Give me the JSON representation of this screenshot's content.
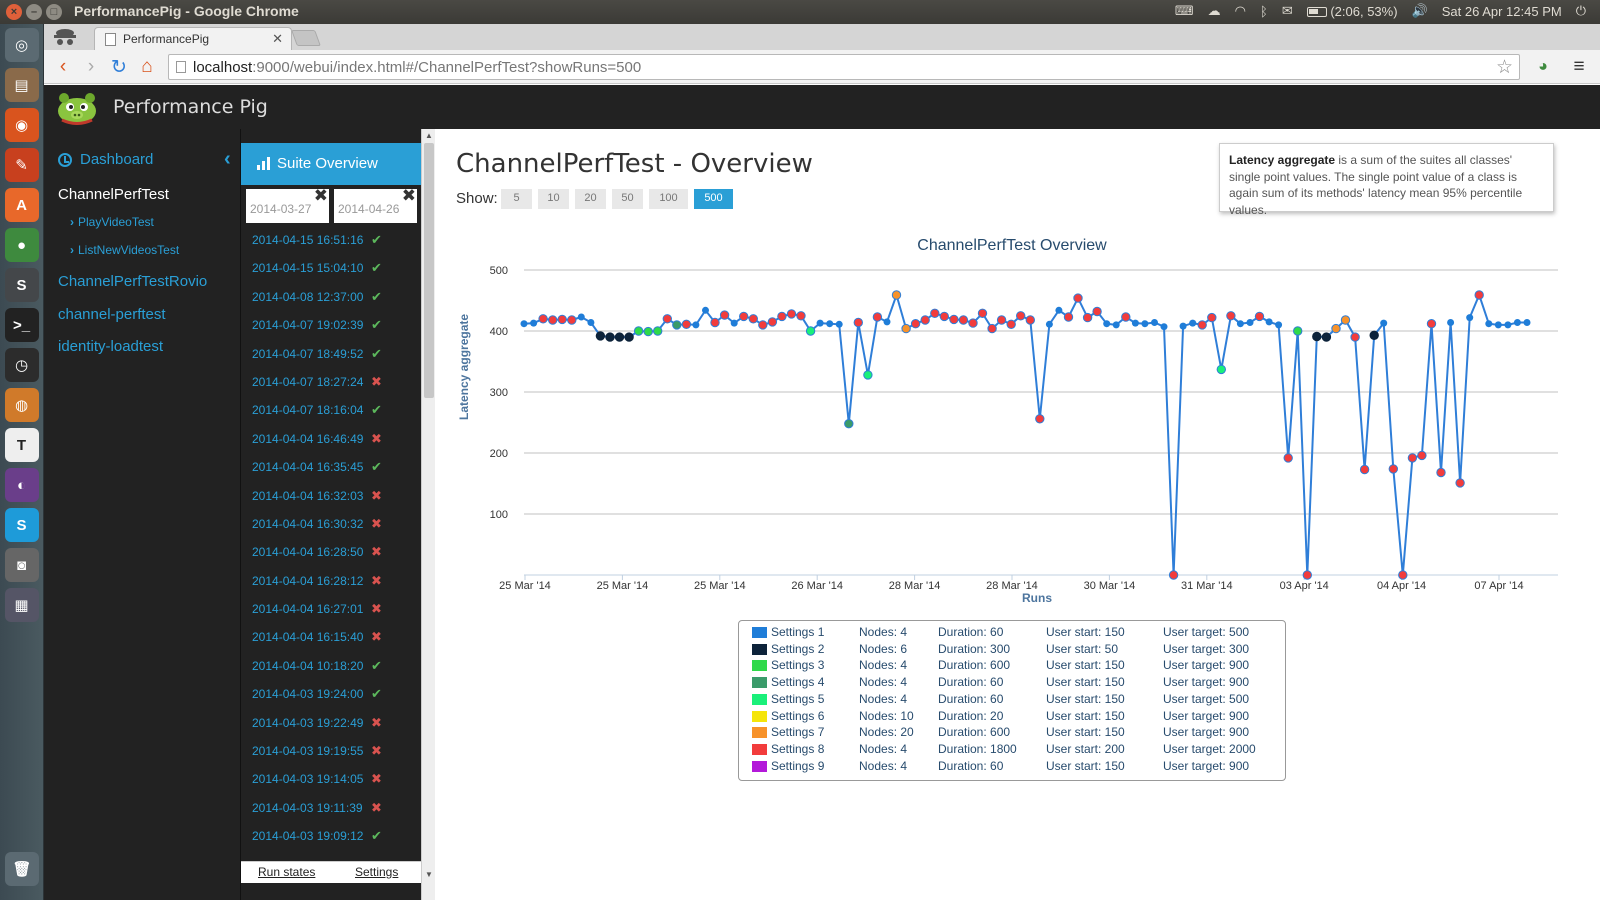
{
  "os": {
    "window_title": "PerformancePig - Google Chrome",
    "battery": "(2:06, 53%)",
    "datetime": "Sat 26 Apr 12:45 PM"
  },
  "browser": {
    "tab_title": "PerformancePig",
    "url_host": "localhost",
    "url_rest": ":9000/webui/index.html#/ChannelPerfTest?showRuns=500"
  },
  "app": {
    "brand": "Performance Pig"
  },
  "sidebar": {
    "dashboard": "Dashboard",
    "projects": [
      {
        "label": "ChannelPerfTest",
        "active": true
      },
      {
        "label": "ChannelPerfTestRovio",
        "active": false
      },
      {
        "label": "channel-perftest",
        "active": false
      },
      {
        "label": "identity-loadtest",
        "active": false
      }
    ],
    "subitems": [
      "PlayVideoTest",
      "ListNewVideosTest"
    ]
  },
  "runs_panel": {
    "header": "Suite Overview",
    "date_from": "2014-03-27",
    "date_to": "2014-04-26",
    "runs": [
      {
        "time": "2014-04-15 16:51:16",
        "ok": true
      },
      {
        "time": "2014-04-15 15:04:10",
        "ok": true
      },
      {
        "time": "2014-04-08 12:37:00",
        "ok": true
      },
      {
        "time": "2014-04-07 19:02:39",
        "ok": true
      },
      {
        "time": "2014-04-07 18:49:52",
        "ok": true
      },
      {
        "time": "2014-04-07 18:27:24",
        "ok": false
      },
      {
        "time": "2014-04-07 18:16:04",
        "ok": true
      },
      {
        "time": "2014-04-04 16:46:49",
        "ok": false
      },
      {
        "time": "2014-04-04 16:35:45",
        "ok": true
      },
      {
        "time": "2014-04-04 16:32:03",
        "ok": false
      },
      {
        "time": "2014-04-04 16:30:32",
        "ok": false
      },
      {
        "time": "2014-04-04 16:28:50",
        "ok": false
      },
      {
        "time": "2014-04-04 16:28:12",
        "ok": false
      },
      {
        "time": "2014-04-04 16:27:01",
        "ok": false
      },
      {
        "time": "2014-04-04 16:15:40",
        "ok": false
      },
      {
        "time": "2014-04-04 10:18:20",
        "ok": true
      },
      {
        "time": "2014-04-03 19:24:00",
        "ok": true
      },
      {
        "time": "2014-04-03 19:22:49",
        "ok": false
      },
      {
        "time": "2014-04-03 19:19:55",
        "ok": false
      },
      {
        "time": "2014-04-03 19:14:05",
        "ok": false
      },
      {
        "time": "2014-04-03 19:11:39",
        "ok": false
      },
      {
        "time": "2014-04-03 19:09:12",
        "ok": true
      }
    ],
    "footer_left": "Run states",
    "footer_right": "Settings"
  },
  "main": {
    "title": "ChannelPerfTest - Overview",
    "show_label": "Show:",
    "show_options": [
      "5",
      "10",
      "20",
      "50",
      "100",
      "500"
    ],
    "show_selected": "500",
    "info_bold": "Latency aggregate",
    "info_text": " is a sum of the suites all classes' single point values. The single point value of a class is again sum of its methods' latency mean 95% percentile values."
  },
  "chart_data": {
    "type": "line",
    "title": "ChannelPerfTest Overview",
    "xlabel": "Runs",
    "ylabel": "Latency aggregate",
    "ylim": [
      0,
      500
    ],
    "y_ticks": [
      100,
      200,
      300,
      400,
      500
    ],
    "x_tick_labels": [
      "25 Mar '14",
      "25 Mar '14",
      "25 Mar '14",
      "26 Mar '14",
      "28 Mar '14",
      "28 Mar '14",
      "30 Mar '14",
      "31 Mar '14",
      "03 Apr '14",
      "04 Apr '14",
      "07 Apr '14"
    ],
    "grid": true,
    "line_color": "#2f7ed8",
    "setting_colors": {
      "1": "#1f7dd8",
      "2": "#0d233a",
      "3": "#2fd94a",
      "4": "#3a9b6a",
      "5": "#1af07a",
      "6": "#f5e50a",
      "7": "#f7922a",
      "8": "#f23c3c",
      "9": "#b319d9"
    },
    "series": [
      {
        "name": "Latency aggregate",
        "points": [
          {
            "y": 412,
            "s": 1
          },
          {
            "y": 413,
            "s": 1
          },
          {
            "y": 420,
            "s": 8
          },
          {
            "y": 418,
            "s": 8
          },
          {
            "y": 419,
            "s": 8
          },
          {
            "y": 418,
            "s": 8
          },
          {
            "y": 423,
            "s": 1
          },
          {
            "y": 414,
            "s": 1
          },
          {
            "y": 392,
            "s": 2
          },
          {
            "y": 390,
            "s": 2
          },
          {
            "y": 390,
            "s": 2
          },
          {
            "y": 390,
            "s": 2
          },
          {
            "y": 400,
            "s": 3
          },
          {
            "y": 399,
            "s": 3
          },
          {
            "y": 400,
            "s": 3
          },
          {
            "y": 420,
            "s": 8
          },
          {
            "y": 410,
            "s": 4
          },
          {
            "y": 411,
            "s": 8
          },
          {
            "y": 410,
            "s": 1
          },
          {
            "y": 434,
            "s": 1
          },
          {
            "y": 414,
            "s": 8
          },
          {
            "y": 426,
            "s": 8
          },
          {
            "y": 413,
            "s": 1
          },
          {
            "y": 424,
            "s": 8
          },
          {
            "y": 420,
            "s": 8
          },
          {
            "y": 410,
            "s": 8
          },
          {
            "y": 415,
            "s": 8
          },
          {
            "y": 424,
            "s": 8
          },
          {
            "y": 428,
            "s": 8
          },
          {
            "y": 425,
            "s": 8
          },
          {
            "y": 400,
            "s": 5
          },
          {
            "y": 413,
            "s": 1
          },
          {
            "y": 412,
            "s": 1
          },
          {
            "y": 411,
            "s": 1
          },
          {
            "y": 248,
            "s": 4
          },
          {
            "y": 414,
            "s": 8
          },
          {
            "y": 328,
            "s": 5
          },
          {
            "y": 423,
            "s": 8
          },
          {
            "y": 415,
            "s": 1
          },
          {
            "y": 459,
            "s": 7
          },
          {
            "y": 404,
            "s": 7
          },
          {
            "y": 412,
            "s": 8
          },
          {
            "y": 418,
            "s": 8
          },
          {
            "y": 429,
            "s": 8
          },
          {
            "y": 424,
            "s": 8
          },
          {
            "y": 419,
            "s": 8
          },
          {
            "y": 418,
            "s": 8
          },
          {
            "y": 413,
            "s": 8
          },
          {
            "y": 429,
            "s": 8
          },
          {
            "y": 404,
            "s": 8
          },
          {
            "y": 418,
            "s": 8
          },
          {
            "y": 411,
            "s": 8
          },
          {
            "y": 425,
            "s": 8
          },
          {
            "y": 418,
            "s": 8
          },
          {
            "y": 256,
            "s": 8
          },
          {
            "y": 411,
            "s": 1
          },
          {
            "y": 434,
            "s": 1
          },
          {
            "y": 423,
            "s": 8
          },
          {
            "y": 454,
            "s": 8
          },
          {
            "y": 422,
            "s": 8
          },
          {
            "y": 432,
            "s": 8
          },
          {
            "y": 412,
            "s": 1
          },
          {
            "y": 410,
            "s": 1
          },
          {
            "y": 423,
            "s": 8
          },
          {
            "y": 413,
            "s": 1
          },
          {
            "y": 412,
            "s": 1
          },
          {
            "y": 414,
            "s": 1
          },
          {
            "y": 407,
            "s": 1
          },
          {
            "y": 0,
            "s": 8
          },
          {
            "y": 408,
            "s": 1
          },
          {
            "y": 413,
            "s": 1
          },
          {
            "y": 410,
            "s": 8
          },
          {
            "y": 422,
            "s": 8
          },
          {
            "y": 337,
            "s": 5
          },
          {
            "y": 425,
            "s": 8
          },
          {
            "y": 412,
            "s": 1
          },
          {
            "y": 414,
            "s": 1
          },
          {
            "y": 424,
            "s": 8
          },
          {
            "y": 415,
            "s": 1
          },
          {
            "y": 410,
            "s": 1
          },
          {
            "y": 192,
            "s": 8
          },
          {
            "y": 400,
            "s": 3
          },
          {
            "y": 0,
            "s": 8
          },
          {
            "y": 391,
            "s": 2
          },
          {
            "y": 390,
            "s": 2
          },
          {
            "y": 404,
            "s": 7
          },
          {
            "y": 418,
            "s": 7
          },
          {
            "y": 390,
            "s": 8
          },
          {
            "y": 173,
            "s": 8
          },
          {
            "y": 393,
            "s": 2
          },
          {
            "y": 413,
            "s": 1
          },
          {
            "y": 174,
            "s": 8
          },
          {
            "y": 0,
            "s": 8
          },
          {
            "y": 192,
            "s": 8
          },
          {
            "y": 196,
            "s": 8
          },
          {
            "y": 412,
            "s": 8
          },
          {
            "y": 168,
            "s": 8
          },
          {
            "y": 414,
            "s": 1
          },
          {
            "y": 151,
            "s": 8
          },
          {
            "y": 422,
            "s": 1
          },
          {
            "y": 459,
            "s": 8
          },
          {
            "y": 412,
            "s": 1
          },
          {
            "y": 410,
            "s": 1
          },
          {
            "y": 410,
            "s": 1
          },
          {
            "y": 414,
            "s": 1
          },
          {
            "y": 414,
            "s": 1
          }
        ]
      }
    ]
  },
  "legend": [
    {
      "name": "Settings 1",
      "color": "#1f7dd8",
      "nodes": "Nodes: 4",
      "duration": "Duration: 60",
      "ustart": "User start: 150",
      "utarget": "User target: 500"
    },
    {
      "name": "Settings 2",
      "color": "#0d233a",
      "nodes": "Nodes: 6",
      "duration": "Duration: 300",
      "ustart": "User start: 50",
      "utarget": "User target: 300"
    },
    {
      "name": "Settings 3",
      "color": "#2fd94a",
      "nodes": "Nodes: 4",
      "duration": "Duration: 600",
      "ustart": "User start: 150",
      "utarget": "User target: 900"
    },
    {
      "name": "Settings 4",
      "color": "#3a9b6a",
      "nodes": "Nodes: 4",
      "duration": "Duration: 60",
      "ustart": "User start: 150",
      "utarget": "User target: 900"
    },
    {
      "name": "Settings 5",
      "color": "#1af07a",
      "nodes": "Nodes: 4",
      "duration": "Duration: 60",
      "ustart": "User start: 150",
      "utarget": "User target: 500"
    },
    {
      "name": "Settings 6",
      "color": "#f5e50a",
      "nodes": "Nodes: 10",
      "duration": "Duration: 20",
      "ustart": "User start: 150",
      "utarget": "User target: 900"
    },
    {
      "name": "Settings 7",
      "color": "#f7922a",
      "nodes": "Nodes: 20",
      "duration": "Duration: 600",
      "ustart": "User start: 150",
      "utarget": "User target: 900"
    },
    {
      "name": "Settings 8",
      "color": "#f23c3c",
      "nodes": "Nodes: 4",
      "duration": "Duration: 1800",
      "ustart": "User start: 200",
      "utarget": "User target: 2000"
    },
    {
      "name": "Settings 9",
      "color": "#b319d9",
      "nodes": "Nodes: 4",
      "duration": "Duration: 60",
      "ustart": "User start: 150",
      "utarget": "User target: 900"
    }
  ]
}
